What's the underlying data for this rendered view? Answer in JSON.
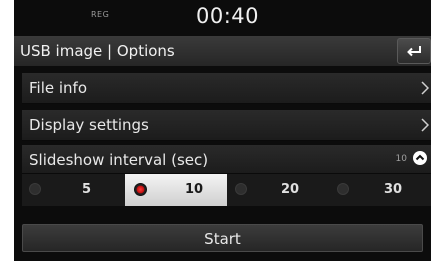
{
  "status": {
    "reg_label": "REG",
    "clock": "00:40"
  },
  "header": {
    "title": "USB image | Options",
    "back_icon": "back-arrow-icon"
  },
  "menu": {
    "items": [
      {
        "label": "File info",
        "icon": "chevron-right-icon"
      },
      {
        "label": "Display settings",
        "icon": "chevron-right-icon"
      }
    ]
  },
  "slideshow": {
    "label": "Slideshow interval (sec)",
    "current_value": "10",
    "collapse_icon": "chevron-up-circle-icon",
    "options": [
      {
        "label": "5",
        "selected": false
      },
      {
        "label": "10",
        "selected": true
      },
      {
        "label": "20",
        "selected": false
      },
      {
        "label": "30",
        "selected": false
      }
    ]
  },
  "actions": {
    "start_label": "Start"
  },
  "colors": {
    "background": "#0c0c0c",
    "row": "#222222",
    "selected_option": "#e6e6e6",
    "radio_active": "#e02020",
    "text": "#e6e6e6"
  }
}
